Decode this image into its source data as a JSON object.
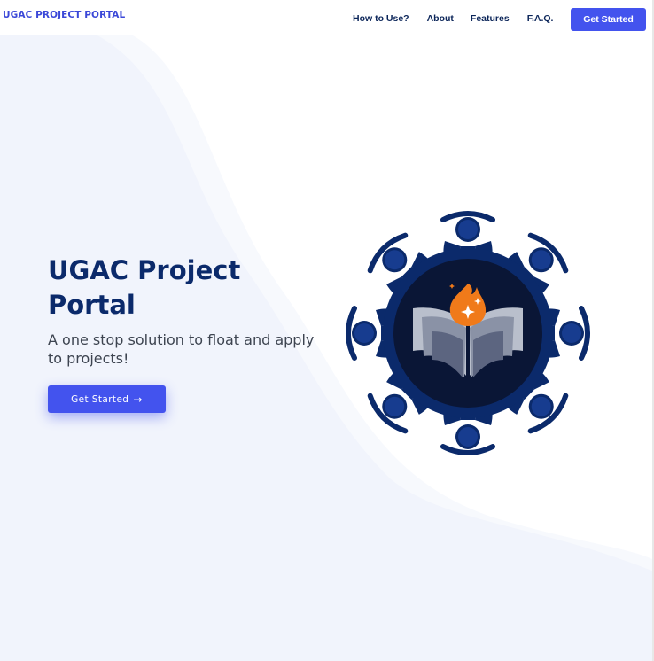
{
  "navbar": {
    "brand": "UGAC PROJECT PORTAL",
    "links": [
      "How to Use?",
      "About",
      "Features",
      "F.A.Q."
    ],
    "cta_label": "Get Started"
  },
  "hero": {
    "title": "UGAC Project Portal",
    "subtitle": "A one stop solution to float and apply to projects!",
    "cta_label": "Get Started",
    "cta_icon": "arrow-right-icon"
  },
  "illustration": {
    "icon": "people-around-book-flame-logo"
  },
  "colors": {
    "accent": "#4353ee",
    "brand": "#3b48d8",
    "heading": "#0b2a6b",
    "logo_navy": "#0b2a6b",
    "flame": "#f07a1a",
    "background_wave": "#f1f4fc"
  }
}
